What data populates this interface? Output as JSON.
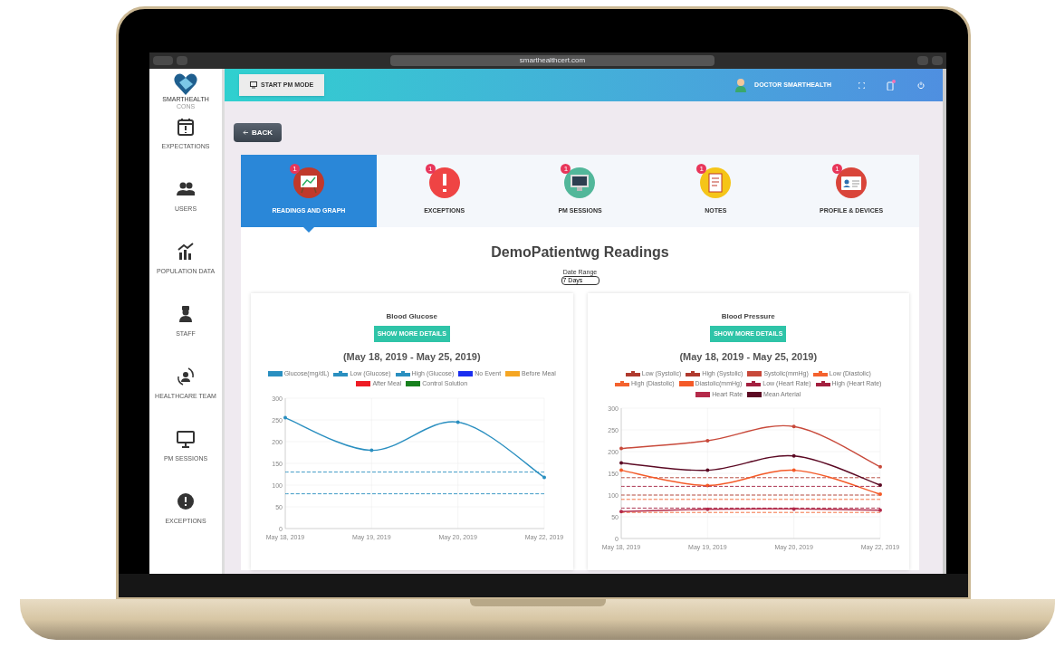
{
  "browser": {
    "url": "smarthealthcert.com"
  },
  "sidebar": {
    "logo_text": "SMARTHEALTH",
    "logo_subtext": "CONS",
    "items": [
      {
        "label": "EXPECTATIONS"
      },
      {
        "label": "USERS"
      },
      {
        "label": "POPULATION DATA"
      },
      {
        "label": "STAFF"
      },
      {
        "label": "HEALTHCARE TEAM"
      },
      {
        "label": "PM SESSIONS"
      },
      {
        "label": "EXCEPTIONS"
      }
    ]
  },
  "header": {
    "button": "START PM MODE",
    "user": "DOCTOR SMARTHEALTH"
  },
  "back_button": "BACK",
  "tabs": [
    {
      "label": "READINGS AND GRAPH",
      "badge": "1",
      "selected": true
    },
    {
      "label": "EXCEPTIONS",
      "badge": "1",
      "selected": false
    },
    {
      "label": "PM SESSIONS",
      "badge": "1",
      "selected": false
    },
    {
      "label": "NOTES",
      "badge": "1",
      "selected": false
    },
    {
      "label": "PROFILE & DEVICES",
      "badge": "1",
      "selected": false
    }
  ],
  "page_title": "DemoPatientwg Readings",
  "date_range": {
    "label": "Date Range",
    "value": "7 Days"
  },
  "charts": [
    {
      "title": "Blood Glucose",
      "button": "SHOW MORE DETAILS",
      "range": "(May 18, 2019 - May 25, 2019)",
      "chart_data": {
        "type": "line",
        "grid": true,
        "categories": [
          "May 18, 2019",
          "May 19, 2019",
          "May 20, 2019",
          "May 22, 2019"
        ],
        "ylim": [
          0,
          300
        ],
        "yticks": [
          0,
          50,
          100,
          150,
          200,
          250,
          300
        ],
        "series": [
          {
            "name": "Glucose(mg/dL)",
            "color": "#2a8fc0",
            "line_style": "solid",
            "values": [
              255,
              180,
              245,
              118
            ]
          },
          {
            "name": "Low (Glucose)",
            "color": "#2a8fc0",
            "line_style": "dashed",
            "values": [
              80,
              80,
              80,
              80
            ]
          },
          {
            "name": "High (Glucose)",
            "color": "#2a8fc0",
            "line_style": "dashed",
            "values": [
              130,
              130,
              130,
              130
            ]
          },
          {
            "name": "No Event",
            "color": "#1a2ef0",
            "line_style": "solid",
            "values": [
              null,
              null,
              null,
              null
            ]
          },
          {
            "name": "Before Meal",
            "color": "#f5a623",
            "line_style": "solid",
            "values": [
              null,
              null,
              null,
              null
            ]
          },
          {
            "name": "After Meal",
            "color": "#ee1c25",
            "line_style": "solid",
            "values": [
              null,
              null,
              null,
              null
            ]
          },
          {
            "name": "Control Solution",
            "color": "#17801e",
            "line_style": "solid",
            "values": [
              null,
              null,
              null,
              null
            ]
          }
        ]
      }
    },
    {
      "title": "Blood Pressure",
      "button": "SHOW MORE DETAILS",
      "range": "(May 18, 2019 - May 25, 2019)",
      "chart_data": {
        "type": "line",
        "grid": true,
        "categories": [
          "May 18, 2019",
          "May 19, 2019",
          "May 20, 2019",
          "May 22, 2019"
        ],
        "ylim": [
          0,
          300
        ],
        "yticks": [
          0,
          50,
          100,
          150,
          200,
          250,
          300
        ],
        "series": [
          {
            "name": "Low (Systolic)",
            "color": "#b03a2e",
            "line_style": "dashed",
            "values": [
              100,
              100,
              100,
              100
            ]
          },
          {
            "name": "High (Systolic)",
            "color": "#b03a2e",
            "line_style": "dashed",
            "values": [
              140,
              140,
              140,
              140
            ]
          },
          {
            "name": "Systolic(mmHg)",
            "color": "#c8493a",
            "line_style": "solid",
            "values": [
              207,
              225,
              258,
              165
            ]
          },
          {
            "name": "Low (Diastolic)",
            "color": "#f4622e",
            "line_style": "dashed",
            "values": [
              60,
              60,
              60,
              60
            ]
          },
          {
            "name": "High (Diastolic)",
            "color": "#f4622e",
            "line_style": "dashed",
            "values": [
              90,
              90,
              90,
              90
            ]
          },
          {
            "name": "Diastolic(mmHg)",
            "color": "#f45a28",
            "line_style": "solid",
            "values": [
              157,
              122,
              157,
              102
            ]
          },
          {
            "name": "Low (Heart Rate)",
            "color": "#a3203f",
            "line_style": "dashed",
            "values": [
              70,
              70,
              70,
              70
            ]
          },
          {
            "name": "High (Heart Rate)",
            "color": "#a3203f",
            "line_style": "dashed",
            "values": [
              120,
              120,
              120,
              120
            ]
          },
          {
            "name": "Heart Rate",
            "color": "#b42a4a",
            "line_style": "solid",
            "values": [
              62,
              67,
              68,
              65
            ]
          },
          {
            "name": "Mean Arterial",
            "color": "#5c0a24",
            "line_style": "solid",
            "values": [
              174,
              157,
              190,
              123
            ]
          }
        ]
      }
    }
  ]
}
